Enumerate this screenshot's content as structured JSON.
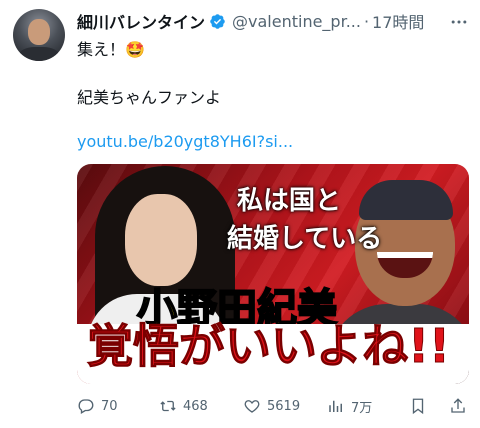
{
  "author": {
    "name": "細川バレンタイン",
    "handle": "@valentine_pr...",
    "separator": "·",
    "time": "17時間"
  },
  "tweet": {
    "line1": "集え！🤩",
    "line2": "紀美ちゃんファンよ",
    "link": "youtu.be/b20ygt8YH6I?si..."
  },
  "thumbnail": {
    "caption_line1": "私は国と",
    "caption_line2": "結婚している",
    "name_band": "小野田紀美",
    "slogan": "覚悟がいいよね!!"
  },
  "actions": {
    "replies": "70",
    "reposts": "468",
    "likes": "5619",
    "views": "7万"
  },
  "colors": {
    "link": "#1d9bf0",
    "muted": "#536471",
    "verified": "#1d9bf0"
  },
  "icons": [
    "more-icon",
    "verified-badge-icon",
    "reply-icon",
    "repost-icon",
    "like-icon",
    "views-icon",
    "bookmark-icon",
    "share-icon"
  ]
}
